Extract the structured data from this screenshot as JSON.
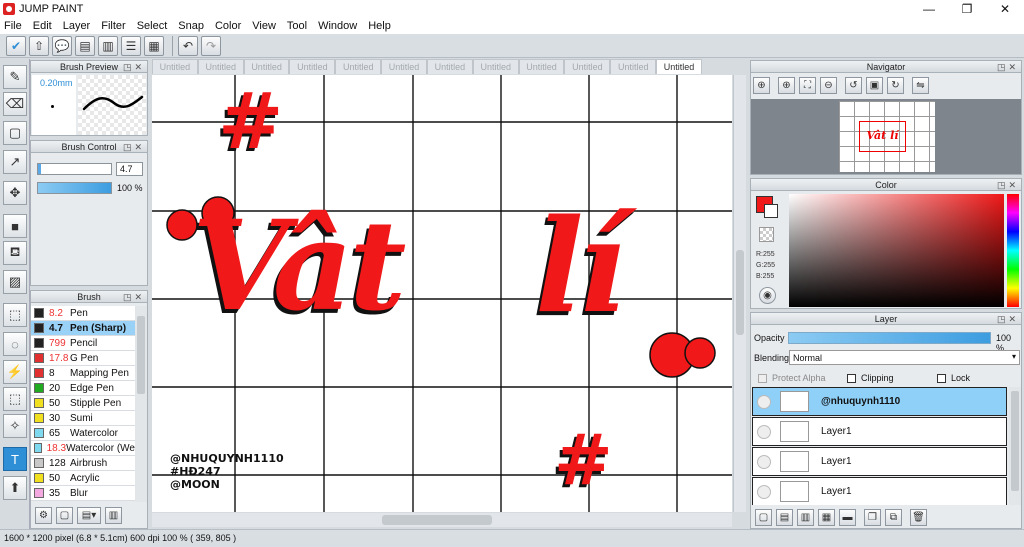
{
  "app": {
    "title": "JUMP PAINT",
    "min": "—",
    "max": "❐",
    "close": "✕"
  },
  "menu": [
    "File",
    "Edit",
    "Layer",
    "Filter",
    "Select",
    "Snap",
    "Color",
    "View",
    "Tool",
    "Window",
    "Help"
  ],
  "toolbar": {
    "icons": [
      "✔",
      "⇧",
      "💬",
      "▤",
      "▥",
      "☰",
      "▦"
    ],
    "undo": "↶",
    "redo": "↷"
  },
  "left_tools": [
    "✎",
    "⌫",
    "▢",
    "↗",
    "✥",
    "■",
    "⛾",
    "▨",
    "⬚",
    "◌",
    "⚡",
    "⬚",
    "✧",
    "T",
    "⬆"
  ],
  "brush_preview": {
    "title": "Brush Preview",
    "size": "0.20mm"
  },
  "brush_control": {
    "title": "Brush Control",
    "size_value": "4.7",
    "opacity_value": "100 %"
  },
  "brush_panel": {
    "title": "Brush",
    "items": [
      {
        "size": "8.2",
        "name": "Pen",
        "color": "#222222",
        "red": true
      },
      {
        "size": "4.7",
        "name": "Pen (Sharp)",
        "color": "#222222",
        "red": false,
        "selected": true
      },
      {
        "size": "799",
        "name": "Pencil",
        "color": "#222222",
        "red": true
      },
      {
        "size": "17.8",
        "name": "G Pen",
        "color": "#e03030",
        "red": true
      },
      {
        "size": "8",
        "name": "Mapping Pen",
        "color": "#e03030",
        "red": false
      },
      {
        "size": "20",
        "name": "Edge Pen",
        "color": "#1faa1f",
        "red": false
      },
      {
        "size": "50",
        "name": "Stipple Pen",
        "color": "#f0e020",
        "red": false
      },
      {
        "size": "30",
        "name": "Sumi",
        "color": "#f0e020",
        "red": false
      },
      {
        "size": "65",
        "name": "Watercolor",
        "color": "#7fd9ef",
        "red": false
      },
      {
        "size": "18.3",
        "name": "Watercolor (We",
        "color": "#7fd9ef",
        "red": true
      },
      {
        "size": "128",
        "name": "Airbrush",
        "color": "#c8c8c8",
        "red": false
      },
      {
        "size": "50",
        "name": "Acrylic",
        "color": "#f0e020",
        "red": false
      },
      {
        "size": "35",
        "name": "Blur",
        "color": "#f4a8e0",
        "red": false
      }
    ]
  },
  "tabs": [
    "Untitled",
    "Untitled",
    "Untitled",
    "Untitled",
    "Untitled",
    "Untitled",
    "Untitled",
    "Untitled",
    "Untitled",
    "Untitled",
    "Untitled",
    "Untitled"
  ],
  "artwork": {
    "text_main1": "Vât",
    "text_main2": "lí",
    "circ": "o",
    "hash": "#",
    "credits": [
      "@NHUQUYNH1110",
      "#HĐ247",
      "@MOON"
    ]
  },
  "navigator": {
    "title": "Navigator",
    "thumb_text": "Vât lí"
  },
  "color_panel": {
    "title": "Color",
    "r": "R:255",
    "g": "G:255",
    "b": "B:255"
  },
  "layer_panel": {
    "title": "Layer",
    "opacity_label": "Opacity",
    "opacity_value": "100 %",
    "blending_label": "Blending",
    "blending_value": "Normal",
    "protect_alpha": "Protect Alpha",
    "clipping": "Clipping",
    "lock": "Lock",
    "layers": [
      {
        "name": "@nhuquynh1110",
        "selected": true
      },
      {
        "name": "Layer1",
        "selected": false
      },
      {
        "name": "Layer1",
        "selected": false
      },
      {
        "name": "Layer1",
        "selected": false
      }
    ]
  },
  "status": {
    "text": "1600 * 1200 pixel   (6.8 * 5.1cm)   600 dpi   100 %   ( 359, 805 )"
  },
  "colors": {
    "accent": "#2f8fd6",
    "art_red": "#f01818",
    "selection": "#9ad2f7"
  }
}
